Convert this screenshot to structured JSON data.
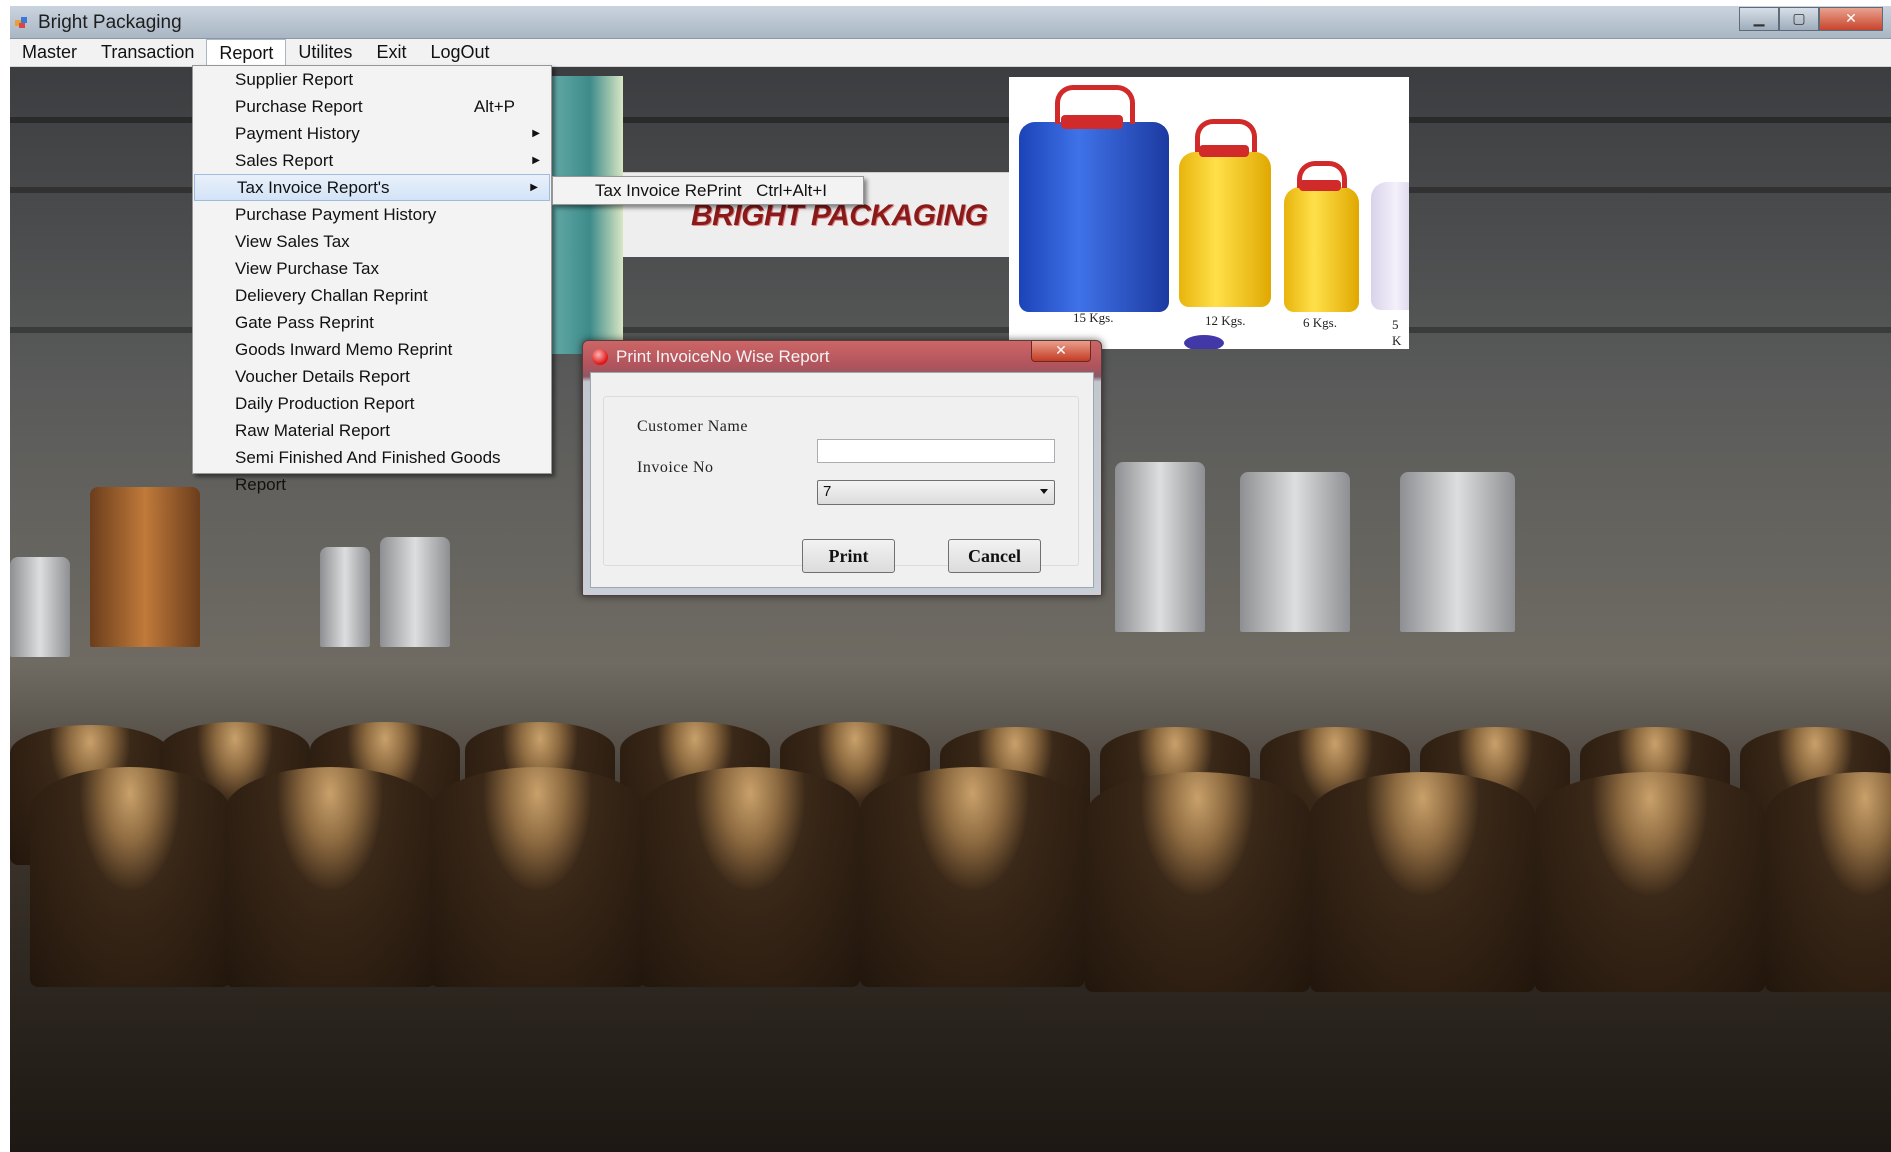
{
  "window": {
    "title": "Bright Packaging",
    "controls": {
      "minimize": "▁",
      "maximize": "▢",
      "close": "✕"
    }
  },
  "menubar": {
    "items": [
      "Master",
      "Transaction",
      "Report",
      "Utilites",
      "Exit",
      "LogOut"
    ],
    "open_menu": "Report"
  },
  "report_menu": {
    "items": [
      {
        "label": "Supplier Report"
      },
      {
        "label": "Purchase Report",
        "shortcut": "Alt+P"
      },
      {
        "label": "Payment History",
        "submenu": true
      },
      {
        "label": "Sales Report",
        "submenu": true
      },
      {
        "label": "Tax Invoice Report's",
        "submenu": true,
        "highlighted": true
      },
      {
        "label": "Purchase Payment History"
      },
      {
        "label": "View Sales Tax"
      },
      {
        "label": "View Purchase Tax"
      },
      {
        "label": "Delievery Challan Reprint"
      },
      {
        "label": "Gate Pass Reprint"
      },
      {
        "label": "Goods Inward Memo Reprint"
      },
      {
        "label": "Voucher Details Report"
      },
      {
        "label": "Daily Production Report"
      },
      {
        "label": "Raw Material Report"
      },
      {
        "label": "Semi Finished And Finished Goods Report"
      }
    ]
  },
  "tax_invoice_submenu": {
    "items": [
      {
        "label": "Tax Invoice RePrint",
        "shortcut": "Ctrl+Alt+I"
      }
    ]
  },
  "banner": {
    "brand": "BRIGHT PACKAGING"
  },
  "product_photo": {
    "labels": [
      "15 Kgs.",
      "12 Kgs.",
      "6 Kgs.",
      "5 K"
    ]
  },
  "dialog": {
    "title": "Print InvoiceNo Wise Report",
    "close": "✕",
    "customer_name_label": "Customer Name",
    "customer_name_value": "",
    "invoice_no_label": "Invoice No",
    "invoice_no_value": "7",
    "print_label": "Print",
    "cancel_label": "Cancel"
  },
  "colors": {
    "brand_text": "#8b1a1a",
    "menu_highlight": "#d3e3f6",
    "dialog_title_bar": "#b0535d"
  }
}
